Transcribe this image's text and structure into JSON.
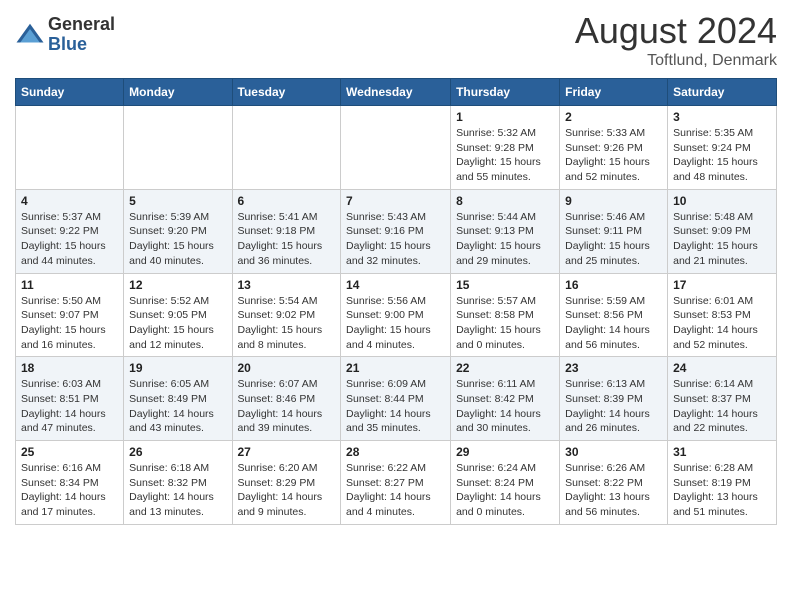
{
  "header": {
    "logo_general": "General",
    "logo_blue": "Blue",
    "month_title": "August 2024",
    "location": "Toftlund, Denmark"
  },
  "days_of_week": [
    "Sunday",
    "Monday",
    "Tuesday",
    "Wednesday",
    "Thursday",
    "Friday",
    "Saturday"
  ],
  "weeks": [
    [
      {
        "day": "",
        "info": ""
      },
      {
        "day": "",
        "info": ""
      },
      {
        "day": "",
        "info": ""
      },
      {
        "day": "",
        "info": ""
      },
      {
        "day": "1",
        "info": "Sunrise: 5:32 AM\nSunset: 9:28 PM\nDaylight: 15 hours\nand 55 minutes."
      },
      {
        "day": "2",
        "info": "Sunrise: 5:33 AM\nSunset: 9:26 PM\nDaylight: 15 hours\nand 52 minutes."
      },
      {
        "day": "3",
        "info": "Sunrise: 5:35 AM\nSunset: 9:24 PM\nDaylight: 15 hours\nand 48 minutes."
      }
    ],
    [
      {
        "day": "4",
        "info": "Sunrise: 5:37 AM\nSunset: 9:22 PM\nDaylight: 15 hours\nand 44 minutes."
      },
      {
        "day": "5",
        "info": "Sunrise: 5:39 AM\nSunset: 9:20 PM\nDaylight: 15 hours\nand 40 minutes."
      },
      {
        "day": "6",
        "info": "Sunrise: 5:41 AM\nSunset: 9:18 PM\nDaylight: 15 hours\nand 36 minutes."
      },
      {
        "day": "7",
        "info": "Sunrise: 5:43 AM\nSunset: 9:16 PM\nDaylight: 15 hours\nand 32 minutes."
      },
      {
        "day": "8",
        "info": "Sunrise: 5:44 AM\nSunset: 9:13 PM\nDaylight: 15 hours\nand 29 minutes."
      },
      {
        "day": "9",
        "info": "Sunrise: 5:46 AM\nSunset: 9:11 PM\nDaylight: 15 hours\nand 25 minutes."
      },
      {
        "day": "10",
        "info": "Sunrise: 5:48 AM\nSunset: 9:09 PM\nDaylight: 15 hours\nand 21 minutes."
      }
    ],
    [
      {
        "day": "11",
        "info": "Sunrise: 5:50 AM\nSunset: 9:07 PM\nDaylight: 15 hours\nand 16 minutes."
      },
      {
        "day": "12",
        "info": "Sunrise: 5:52 AM\nSunset: 9:05 PM\nDaylight: 15 hours\nand 12 minutes."
      },
      {
        "day": "13",
        "info": "Sunrise: 5:54 AM\nSunset: 9:02 PM\nDaylight: 15 hours\nand 8 minutes."
      },
      {
        "day": "14",
        "info": "Sunrise: 5:56 AM\nSunset: 9:00 PM\nDaylight: 15 hours\nand 4 minutes."
      },
      {
        "day": "15",
        "info": "Sunrise: 5:57 AM\nSunset: 8:58 PM\nDaylight: 15 hours\nand 0 minutes."
      },
      {
        "day": "16",
        "info": "Sunrise: 5:59 AM\nSunset: 8:56 PM\nDaylight: 14 hours\nand 56 minutes."
      },
      {
        "day": "17",
        "info": "Sunrise: 6:01 AM\nSunset: 8:53 PM\nDaylight: 14 hours\nand 52 minutes."
      }
    ],
    [
      {
        "day": "18",
        "info": "Sunrise: 6:03 AM\nSunset: 8:51 PM\nDaylight: 14 hours\nand 47 minutes."
      },
      {
        "day": "19",
        "info": "Sunrise: 6:05 AM\nSunset: 8:49 PM\nDaylight: 14 hours\nand 43 minutes."
      },
      {
        "day": "20",
        "info": "Sunrise: 6:07 AM\nSunset: 8:46 PM\nDaylight: 14 hours\nand 39 minutes."
      },
      {
        "day": "21",
        "info": "Sunrise: 6:09 AM\nSunset: 8:44 PM\nDaylight: 14 hours\nand 35 minutes."
      },
      {
        "day": "22",
        "info": "Sunrise: 6:11 AM\nSunset: 8:42 PM\nDaylight: 14 hours\nand 30 minutes."
      },
      {
        "day": "23",
        "info": "Sunrise: 6:13 AM\nSunset: 8:39 PM\nDaylight: 14 hours\nand 26 minutes."
      },
      {
        "day": "24",
        "info": "Sunrise: 6:14 AM\nSunset: 8:37 PM\nDaylight: 14 hours\nand 22 minutes."
      }
    ],
    [
      {
        "day": "25",
        "info": "Sunrise: 6:16 AM\nSunset: 8:34 PM\nDaylight: 14 hours\nand 17 minutes."
      },
      {
        "day": "26",
        "info": "Sunrise: 6:18 AM\nSunset: 8:32 PM\nDaylight: 14 hours\nand 13 minutes."
      },
      {
        "day": "27",
        "info": "Sunrise: 6:20 AM\nSunset: 8:29 PM\nDaylight: 14 hours\nand 9 minutes."
      },
      {
        "day": "28",
        "info": "Sunrise: 6:22 AM\nSunset: 8:27 PM\nDaylight: 14 hours\nand 4 minutes."
      },
      {
        "day": "29",
        "info": "Sunrise: 6:24 AM\nSunset: 8:24 PM\nDaylight: 14 hours\nand 0 minutes."
      },
      {
        "day": "30",
        "info": "Sunrise: 6:26 AM\nSunset: 8:22 PM\nDaylight: 13 hours\nand 56 minutes."
      },
      {
        "day": "31",
        "info": "Sunrise: 6:28 AM\nSunset: 8:19 PM\nDaylight: 13 hours\nand 51 minutes."
      }
    ]
  ]
}
